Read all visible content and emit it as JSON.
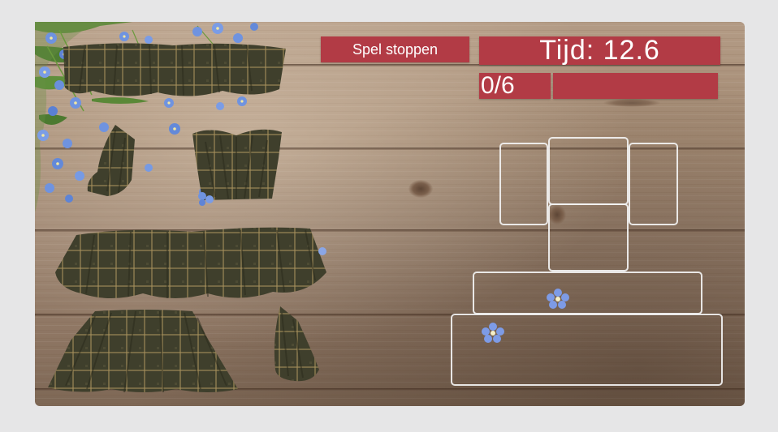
{
  "game": {
    "stop_button_label": "Spel stoppen",
    "timer_text": "Tijd: 12.6",
    "score_text": "0/6",
    "progress_fraction": 0
  },
  "pieces": [
    "top-frill-piece",
    "bodice-piece",
    "left-sleeve-piece",
    "waist-ruffle-piece",
    "skirt-piece",
    "right-sleeve-piece"
  ],
  "target_slots": 6,
  "colors": {
    "hud_red": "#b23b45",
    "hud_text": "#ffffff",
    "slot_outline": "#f2f2f2",
    "fabric_dark": "#3f3f2c",
    "fabric_grid": "#a58f5a",
    "flower_blue": "#6f93e0",
    "page_bg": "#e6e6e7"
  }
}
